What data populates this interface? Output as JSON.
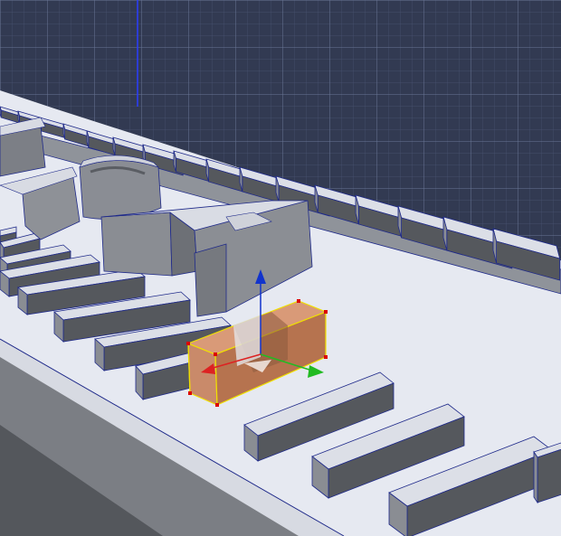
{
  "viewport": {
    "view": "perspective",
    "background_grid_color": "#323a52",
    "grid_line_color": "#5a6584",
    "ground_color": "#e6e9f1",
    "block_top_color": "#dcdfe7",
    "block_side_color": "#8a8d93",
    "block_dark_color": "#55585d",
    "edge_color": "#1f2a8a"
  },
  "selected_object": {
    "name": "box",
    "state": "selected",
    "fill_color": "#c98a6a",
    "outline_color": "#f0e000",
    "vertex_color": "#dd0000"
  },
  "gizmo": {
    "type": "move",
    "axes": [
      {
        "axis": "x",
        "color": "#dd2222"
      },
      {
        "axis": "y",
        "color": "#22bb22"
      },
      {
        "axis": "z",
        "color": "#1133cc"
      }
    ]
  }
}
